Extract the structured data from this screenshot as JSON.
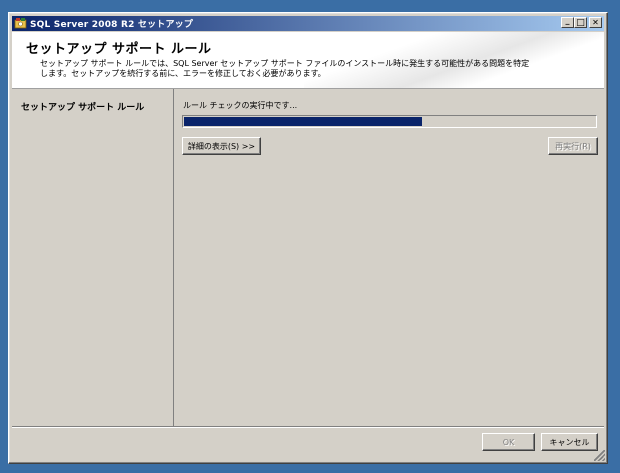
{
  "window": {
    "title": "SQL Server 2008 R2 セットアップ",
    "minimize_glyph": "_",
    "maximize_glyph": "□",
    "close_glyph": "✕"
  },
  "header": {
    "title": "セットアップ サポート ルール",
    "description": "セットアップ サポート ルールでは、SQL Server セットアップ サポート ファイルのインストール時に発生する可能性がある問題を特定します。セットアップを続行する前に、エラーを修正しておく必要があります。"
  },
  "sidebar": {
    "items": [
      {
        "label": "セットアップ サポート ルール",
        "active": true
      }
    ]
  },
  "main": {
    "status_text": "ルール チェックの実行中です...",
    "progress_percent": 58,
    "details_button": "詳細の表示(S) >>",
    "rerun_button": "再実行(R)"
  },
  "footer": {
    "ok_button": "OK",
    "cancel_button": "キャンセル"
  },
  "colors": {
    "desktop": "#3a6ea5",
    "titlebar_start": "#0a246a",
    "titlebar_end": "#a6caf0",
    "progress_fill": "#0a246a",
    "face": "#d4d0c8"
  },
  "icons": {
    "title_icon": "sql-server-setup-icon"
  }
}
